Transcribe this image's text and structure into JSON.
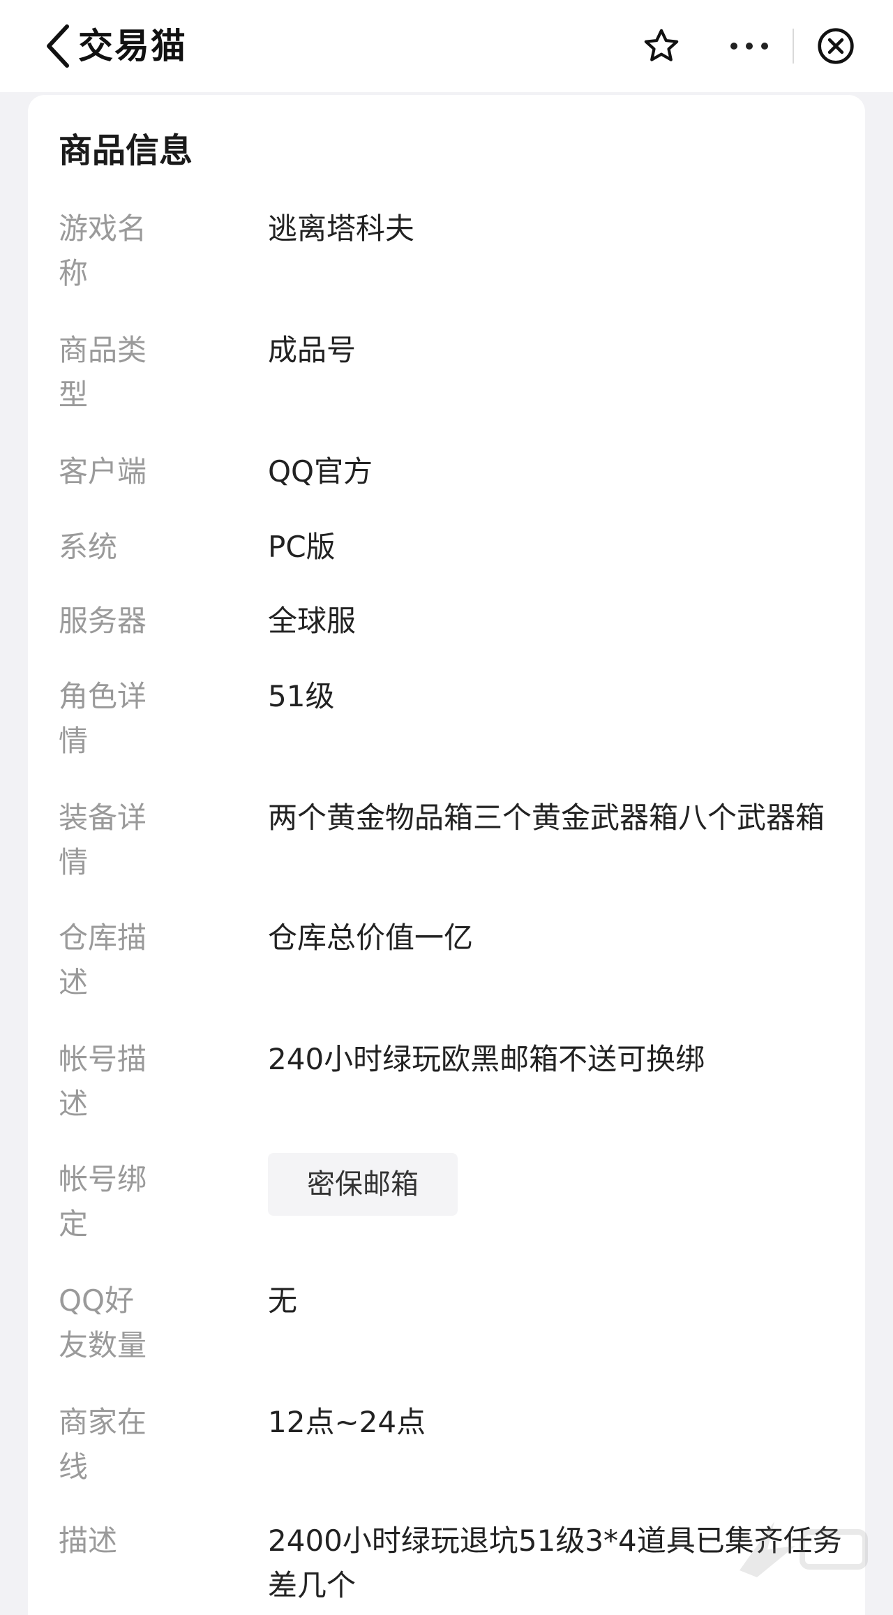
{
  "header": {
    "title": "交易猫",
    "icons": {
      "back": "chevron-left-icon",
      "favorite": "star-icon",
      "more": "more-dots-icon",
      "close": "close-circle-icon"
    }
  },
  "card": {
    "title": "商品信息",
    "rows": [
      {
        "label": "游戏名称",
        "value": "逃离塔科夫"
      },
      {
        "label": "商品类型",
        "value": "成品号"
      },
      {
        "label": "客户端",
        "value": "QQ官方"
      },
      {
        "label": "系统",
        "value": "PC版"
      },
      {
        "label": "服务器",
        "value": "全球服"
      },
      {
        "label": "角色详情",
        "value": "51级"
      },
      {
        "label": "装备详情",
        "value": "两个黄金物品箱三个黄金武器箱八个武器箱"
      },
      {
        "label": "仓库描述",
        "value": "仓库总价值一亿"
      },
      {
        "label": "帐号描述",
        "value": "240小时绿玩欧黑邮箱不送可换绑"
      },
      {
        "label": "帐号绑定",
        "tag": "密保邮箱"
      },
      {
        "label": "QQ好友数量",
        "value": "无"
      },
      {
        "label": "商家在线",
        "value": "12点~24点"
      },
      {
        "label": "描述",
        "value": "2400小时绿玩退坑51级3*4道具已集齐任务差几个"
      }
    ]
  }
}
